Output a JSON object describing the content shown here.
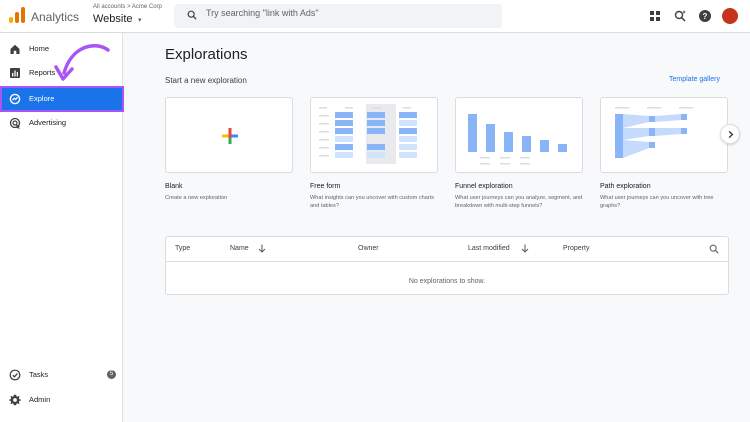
{
  "app": {
    "name": "Analytics",
    "breadcrumb": "All accounts  >  Acme Corp",
    "property": "Website",
    "property_caret": "▾"
  },
  "search": {
    "placeholder": "Try searching \"link with Ads\""
  },
  "header_icons": [
    "apps-grid-icon",
    "search-insights-icon",
    "help-icon",
    "account-avatar"
  ],
  "colors": {
    "accent": "#1a73e8",
    "highlight": "#a855f7",
    "avatar": "#c5341d",
    "logo": [
      "#f9ab00",
      "#e37400",
      "#e37400"
    ]
  },
  "sidebar": {
    "items": [
      {
        "label": "Home",
        "icon": "home-icon"
      },
      {
        "label": "Reports",
        "icon": "bar-chart-icon"
      },
      {
        "label": "Explore",
        "icon": "explore-icon",
        "active": true
      },
      {
        "label": "Advertising",
        "icon": "advertising-icon"
      }
    ],
    "bottom_items": [
      {
        "label": "Tasks",
        "icon": "check-circle-icon",
        "badge": "5"
      },
      {
        "label": "Admin",
        "icon": "gear-icon"
      }
    ]
  },
  "main": {
    "title": "Explorations",
    "section_label": "Start a new exploration",
    "gallery_link": "Template gallery",
    "cards": [
      {
        "title": "Blank",
        "desc": "Create a new exploration"
      },
      {
        "title": "Free form",
        "desc": "What insights can you uncover with custom charts and tables?"
      },
      {
        "title": "Funnel exploration",
        "desc": "What user journeys can you analyze, segment, and breakdown with multi-step funnels?"
      },
      {
        "title": "Path exploration",
        "desc": "What user journeys can you uncover with tree graphs?"
      }
    ]
  },
  "table": {
    "columns": [
      "Type",
      "Name",
      "Owner",
      "Last modified",
      "Property"
    ],
    "empty_message": "No explorations to show."
  }
}
